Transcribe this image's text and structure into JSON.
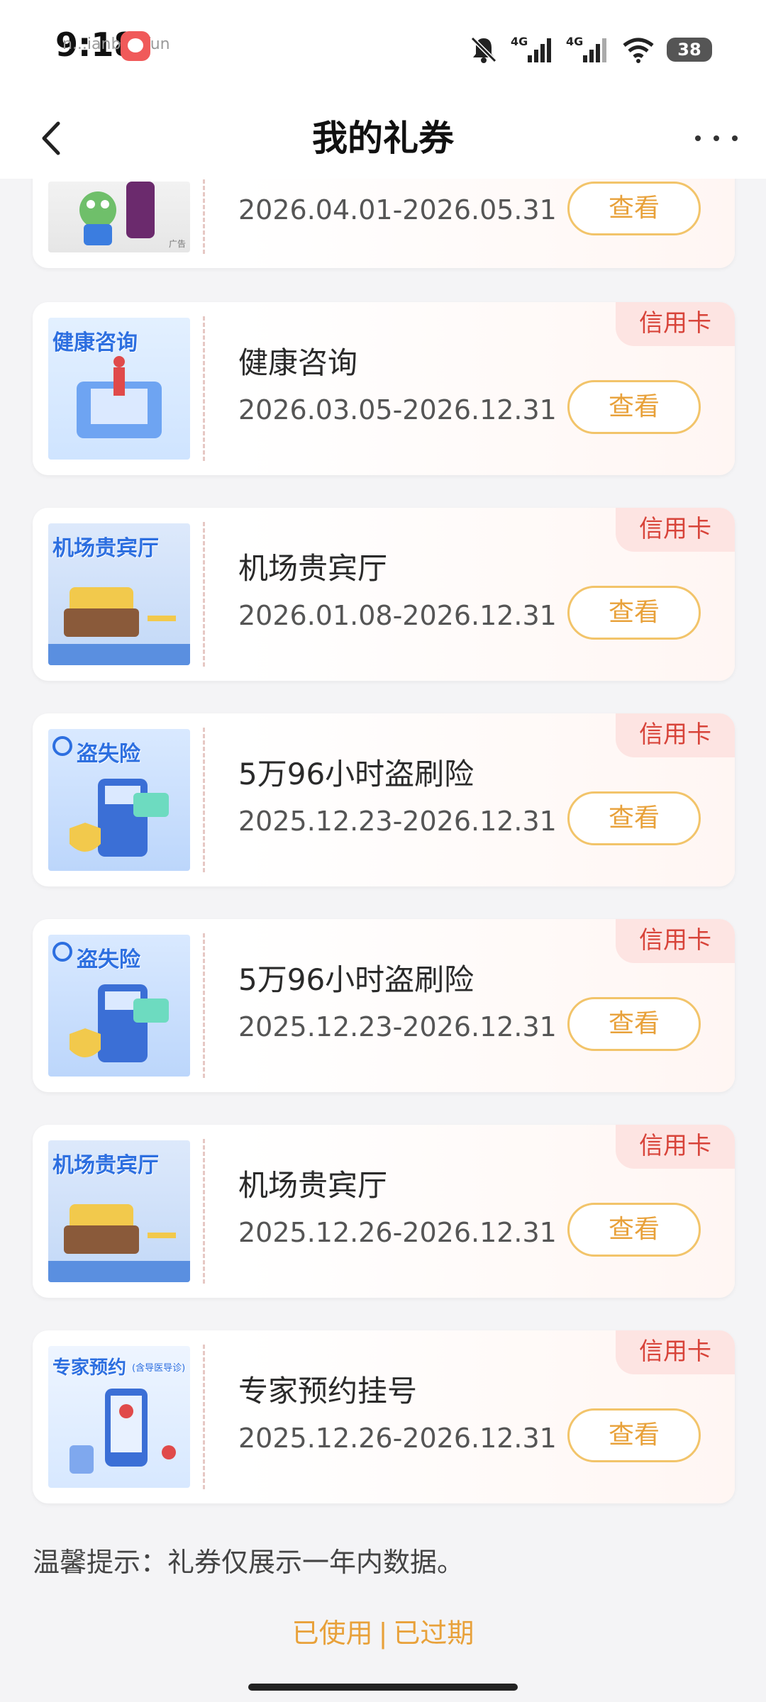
{
  "status_bar": {
    "time": "9:18",
    "watermark": "n...ianbao.fun",
    "battery": "38"
  },
  "nav": {
    "title": "我的礼券"
  },
  "coupons": [
    {
      "title": "",
      "date": "2026.04.01-2026.05.31",
      "badge": "",
      "button": "查看",
      "thumb_text": "广告"
    },
    {
      "title": "健康咨询",
      "date": "2026.03.05-2026.12.31",
      "badge": "信用卡",
      "button": "查看",
      "thumb_text": "健康咨询"
    },
    {
      "title": "机场贵宾厅",
      "date": "2026.01.08-2026.12.31",
      "badge": "信用卡",
      "button": "查看",
      "thumb_text": "机场贵宾厅"
    },
    {
      "title": "5万96小时盗刷险",
      "date": "2025.12.23-2026.12.31",
      "badge": "信用卡",
      "button": "查看",
      "thumb_text": "盗失险"
    },
    {
      "title": "5万96小时盗刷险",
      "date": "2025.12.23-2026.12.31",
      "badge": "信用卡",
      "button": "查看",
      "thumb_text": "盗失险"
    },
    {
      "title": "机场贵宾厅",
      "date": "2025.12.26-2026.12.31",
      "badge": "信用卡",
      "button": "查看",
      "thumb_text": "机场贵宾厅"
    },
    {
      "title": "专家预约挂号",
      "date": "2025.12.26-2026.12.31",
      "badge": "信用卡",
      "button": "查看",
      "thumb_text": "专家预约",
      "thumb_sub": "(含导医导诊)"
    }
  ],
  "tip": "温馨提示：礼券仅展示一年内数据。",
  "footer": {
    "used": "已使用",
    "separator": "|",
    "expired": "已过期"
  },
  "colors": {
    "accent": "#e8a13a",
    "badge_bg": "#fde4e2",
    "badge_text": "#d8443a"
  }
}
